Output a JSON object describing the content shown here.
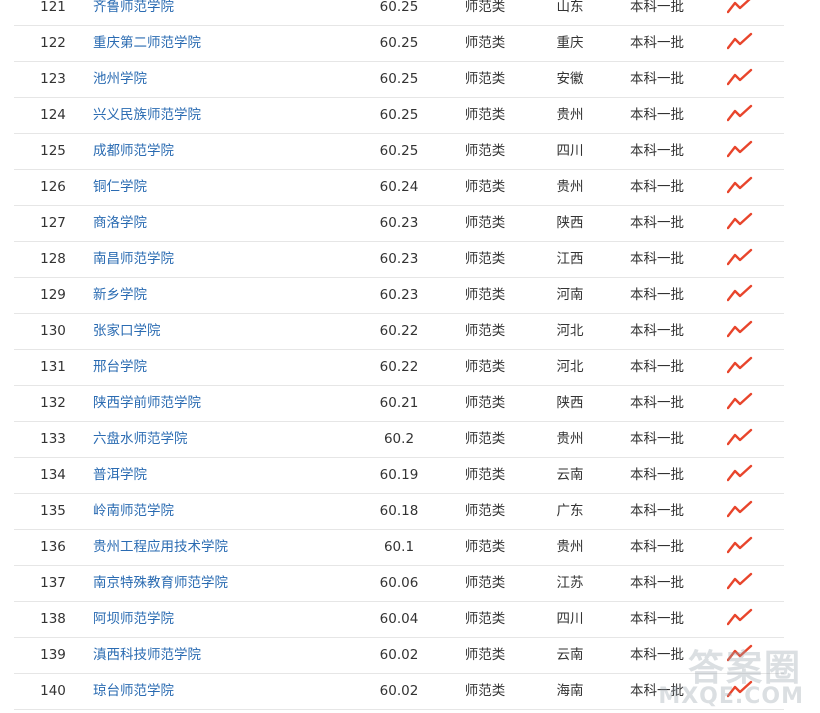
{
  "rows": [
    {
      "rank": "121",
      "name": "齐鲁师范学院",
      "score": "60.25",
      "type": "师范类",
      "province": "山东",
      "batch": "本科一批",
      "trend_icon": "trend-up-icon"
    },
    {
      "rank": "122",
      "name": "重庆第二师范学院",
      "score": "60.25",
      "type": "师范类",
      "province": "重庆",
      "batch": "本科一批",
      "trend_icon": "trend-up-icon"
    },
    {
      "rank": "123",
      "name": "池州学院",
      "score": "60.25",
      "type": "师范类",
      "province": "安徽",
      "batch": "本科一批",
      "trend_icon": "trend-up-icon"
    },
    {
      "rank": "124",
      "name": "兴义民族师范学院",
      "score": "60.25",
      "type": "师范类",
      "province": "贵州",
      "batch": "本科一批",
      "trend_icon": "trend-up-icon"
    },
    {
      "rank": "125",
      "name": "成都师范学院",
      "score": "60.25",
      "type": "师范类",
      "province": "四川",
      "batch": "本科一批",
      "trend_icon": "trend-up-icon"
    },
    {
      "rank": "126",
      "name": "铜仁学院",
      "score": "60.24",
      "type": "师范类",
      "province": "贵州",
      "batch": "本科一批",
      "trend_icon": "trend-up-icon"
    },
    {
      "rank": "127",
      "name": "商洛学院",
      "score": "60.23",
      "type": "师范类",
      "province": "陕西",
      "batch": "本科一批",
      "trend_icon": "trend-up-icon"
    },
    {
      "rank": "128",
      "name": "南昌师范学院",
      "score": "60.23",
      "type": "师范类",
      "province": "江西",
      "batch": "本科一批",
      "trend_icon": "trend-up-icon"
    },
    {
      "rank": "129",
      "name": "新乡学院",
      "score": "60.23",
      "type": "师范类",
      "province": "河南",
      "batch": "本科一批",
      "trend_icon": "trend-up-icon"
    },
    {
      "rank": "130",
      "name": "张家口学院",
      "score": "60.22",
      "type": "师范类",
      "province": "河北",
      "batch": "本科一批",
      "trend_icon": "trend-up-icon"
    },
    {
      "rank": "131",
      "name": "邢台学院",
      "score": "60.22",
      "type": "师范类",
      "province": "河北",
      "batch": "本科一批",
      "trend_icon": "trend-up-icon"
    },
    {
      "rank": "132",
      "name": "陕西学前师范学院",
      "score": "60.21",
      "type": "师范类",
      "province": "陕西",
      "batch": "本科一批",
      "trend_icon": "trend-up-icon"
    },
    {
      "rank": "133",
      "name": "六盘水师范学院",
      "score": "60.2",
      "type": "师范类",
      "province": "贵州",
      "batch": "本科一批",
      "trend_icon": "trend-up-icon"
    },
    {
      "rank": "134",
      "name": "普洱学院",
      "score": "60.19",
      "type": "师范类",
      "province": "云南",
      "batch": "本科一批",
      "trend_icon": "trend-up-icon"
    },
    {
      "rank": "135",
      "name": "岭南师范学院",
      "score": "60.18",
      "type": "师范类",
      "province": "广东",
      "batch": "本科一批",
      "trend_icon": "trend-up-icon"
    },
    {
      "rank": "136",
      "name": "贵州工程应用技术学院",
      "score": "60.1",
      "type": "师范类",
      "province": "贵州",
      "batch": "本科一批",
      "trend_icon": "trend-up-icon"
    },
    {
      "rank": "137",
      "name": "南京特殊教育师范学院",
      "score": "60.06",
      "type": "师范类",
      "province": "江苏",
      "batch": "本科一批",
      "trend_icon": "trend-up-icon"
    },
    {
      "rank": "138",
      "name": "阿坝师范学院",
      "score": "60.04",
      "type": "师范类",
      "province": "四川",
      "batch": "本科一批",
      "trend_icon": "trend-up-icon"
    },
    {
      "rank": "139",
      "name": "滇西科技师范学院",
      "score": "60.02",
      "type": "师范类",
      "province": "云南",
      "batch": "本科一批",
      "trend_icon": "trend-up-icon"
    },
    {
      "rank": "140",
      "name": "琼台师范学院",
      "score": "60.02",
      "type": "师范类",
      "province": "海南",
      "batch": "本科一批",
      "trend_icon": "trend-up-icon"
    }
  ],
  "colors": {
    "link": "#2a6bb2",
    "text": "#333333",
    "trend": "#e8452c",
    "divider": "#e6e6e6"
  },
  "watermark": {
    "cn": "答案圈",
    "en": "MXQE.COM"
  }
}
